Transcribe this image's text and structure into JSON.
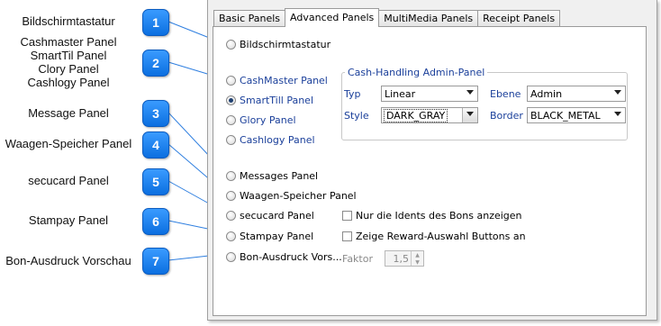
{
  "callouts": [
    {
      "num": "1",
      "text": "Bildschirmtastatur"
    },
    {
      "num": "2",
      "text": "Cashmaster Panel\nSmartTil Panel\nClory Panel\nCashlogy Panel"
    },
    {
      "num": "3",
      "text": "Message Panel"
    },
    {
      "num": "4",
      "text": "Waagen-Speicher Panel"
    },
    {
      "num": "5",
      "text": "secucard Panel"
    },
    {
      "num": "6",
      "text": "Stampay Panel"
    },
    {
      "num": "7",
      "text": "Bon-Ausdruck Vorschau"
    }
  ],
  "tabs": [
    "Basic Panels",
    "Advanced Panels",
    "MultiMedia Panels",
    "Receipt Panels"
  ],
  "active_tab": "Advanced Panels",
  "radios": {
    "bildschirmtastatur": "Bildschirmtastatur",
    "cashmaster": "CashMaster Panel",
    "smarttill": "SmartTill Panel",
    "glory": "Glory Panel",
    "cashlogy": "Cashlogy Panel",
    "messages": "Messages Panel",
    "waagen": "Waagen-Speicher Panel",
    "secucard": "secucard Panel",
    "stampay": "Stampay Panel",
    "bon": "Bon-Ausdruck Vors..."
  },
  "selected_radio": "smarttill",
  "cash_group": {
    "legend": "Cash-Handling Admin-Panel",
    "typ_label": "Typ",
    "typ_value": "Linear",
    "ebene_label": "Ebene",
    "ebene_value": "Admin",
    "style_label": "Style",
    "style_value": "DARK_GRAY",
    "border_label": "Border",
    "border_value": "BLACK_METAL"
  },
  "checkboxes": {
    "idents": "Nur die Idents des Bons anzeigen",
    "reward": "Zeige Reward-Auswahl Buttons an"
  },
  "faktor": {
    "label": "Faktor",
    "value": "1,5"
  },
  "colors": {
    "badge": "#1a7ff0",
    "accent_text": "#1a3f9a"
  }
}
